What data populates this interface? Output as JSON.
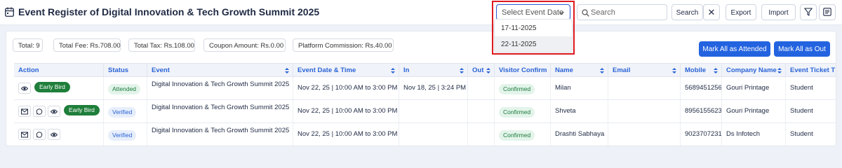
{
  "header": {
    "title": "Event Register of Digital Innovation & Tech Growth Summit 2025",
    "date_select": {
      "label": "Select Event Date",
      "options": [
        "17-11-2025",
        "22-11-2025"
      ]
    },
    "search": {
      "placeholder": "Search",
      "value": ""
    },
    "buttons": {
      "search": "Search",
      "clear": "✕",
      "export": "Export",
      "import": "Import"
    }
  },
  "stats": {
    "total": "Total: 9",
    "total_fee": "Total Fee: Rs.708.00",
    "total_tax": "Total Tax: Rs.108.00",
    "coupon_amount": "Coupon Amount: Rs.0.00",
    "platform_commission": "Platform Commission: Rs.40.00"
  },
  "actions": {
    "mark_all_attended": "Mark All as Attended",
    "mark_all_out": "Mark All as Out"
  },
  "table": {
    "columns": [
      "Action",
      "Status",
      "Event",
      "Event Date & Time",
      "In",
      "Out",
      "Visitor Confirm",
      "Name",
      "Email",
      "Mobile",
      "Company Name",
      "Event Ticket T"
    ],
    "rows": [
      {
        "early_bird": "Early Bird",
        "status": "Attended",
        "event": "Digital Innovation & Tech Growth Summit 2025",
        "date_time": "Nov 22, 25 | 10:00 AM to 3:00 PM",
        "in": "Nov 18, 25 | 3:24 PM",
        "out": "",
        "visitor_confirm": "Confirmed",
        "name": "Milan",
        "email": "",
        "mobile": "5689451256",
        "company": "Gouri Printage",
        "ticket": "Student"
      },
      {
        "early_bird": "Early Bird",
        "status": "Verified",
        "event": "Digital Innovation & Tech Growth Summit 2025",
        "date_time": "Nov 22, 25 | 10:00 AM to 3:00 PM",
        "in": "",
        "out": "",
        "visitor_confirm": "Confirmed",
        "name": "Shveta",
        "email": "",
        "mobile": "8956155623",
        "company": "Gouri Printage",
        "ticket": "Student"
      },
      {
        "early_bird": "",
        "status": "Verified",
        "event": "Digital Innovation & Tech Growth Summit 2025",
        "date_time": "Nov 22, 25 | 10:00 AM to 3:00 PM",
        "in": "",
        "out": "",
        "visitor_confirm": "Confirmed",
        "name": "Drashti Sabhaya",
        "email": "",
        "mobile": "9023707231",
        "company": "Ds Infotech",
        "ticket": "Student"
      }
    ]
  },
  "colors": {
    "accent": "#2363e0",
    "header_text": "#2a63d6",
    "success_badge": "#1e7e3a",
    "highlight_border": "#e0191f"
  },
  "icons": [
    "calendar-icon",
    "chevron-down-icon",
    "search-icon",
    "close-icon",
    "filter-icon",
    "export-list-icon",
    "eye-icon",
    "mail-icon",
    "whatsapp-icon",
    "sort-icon"
  ]
}
